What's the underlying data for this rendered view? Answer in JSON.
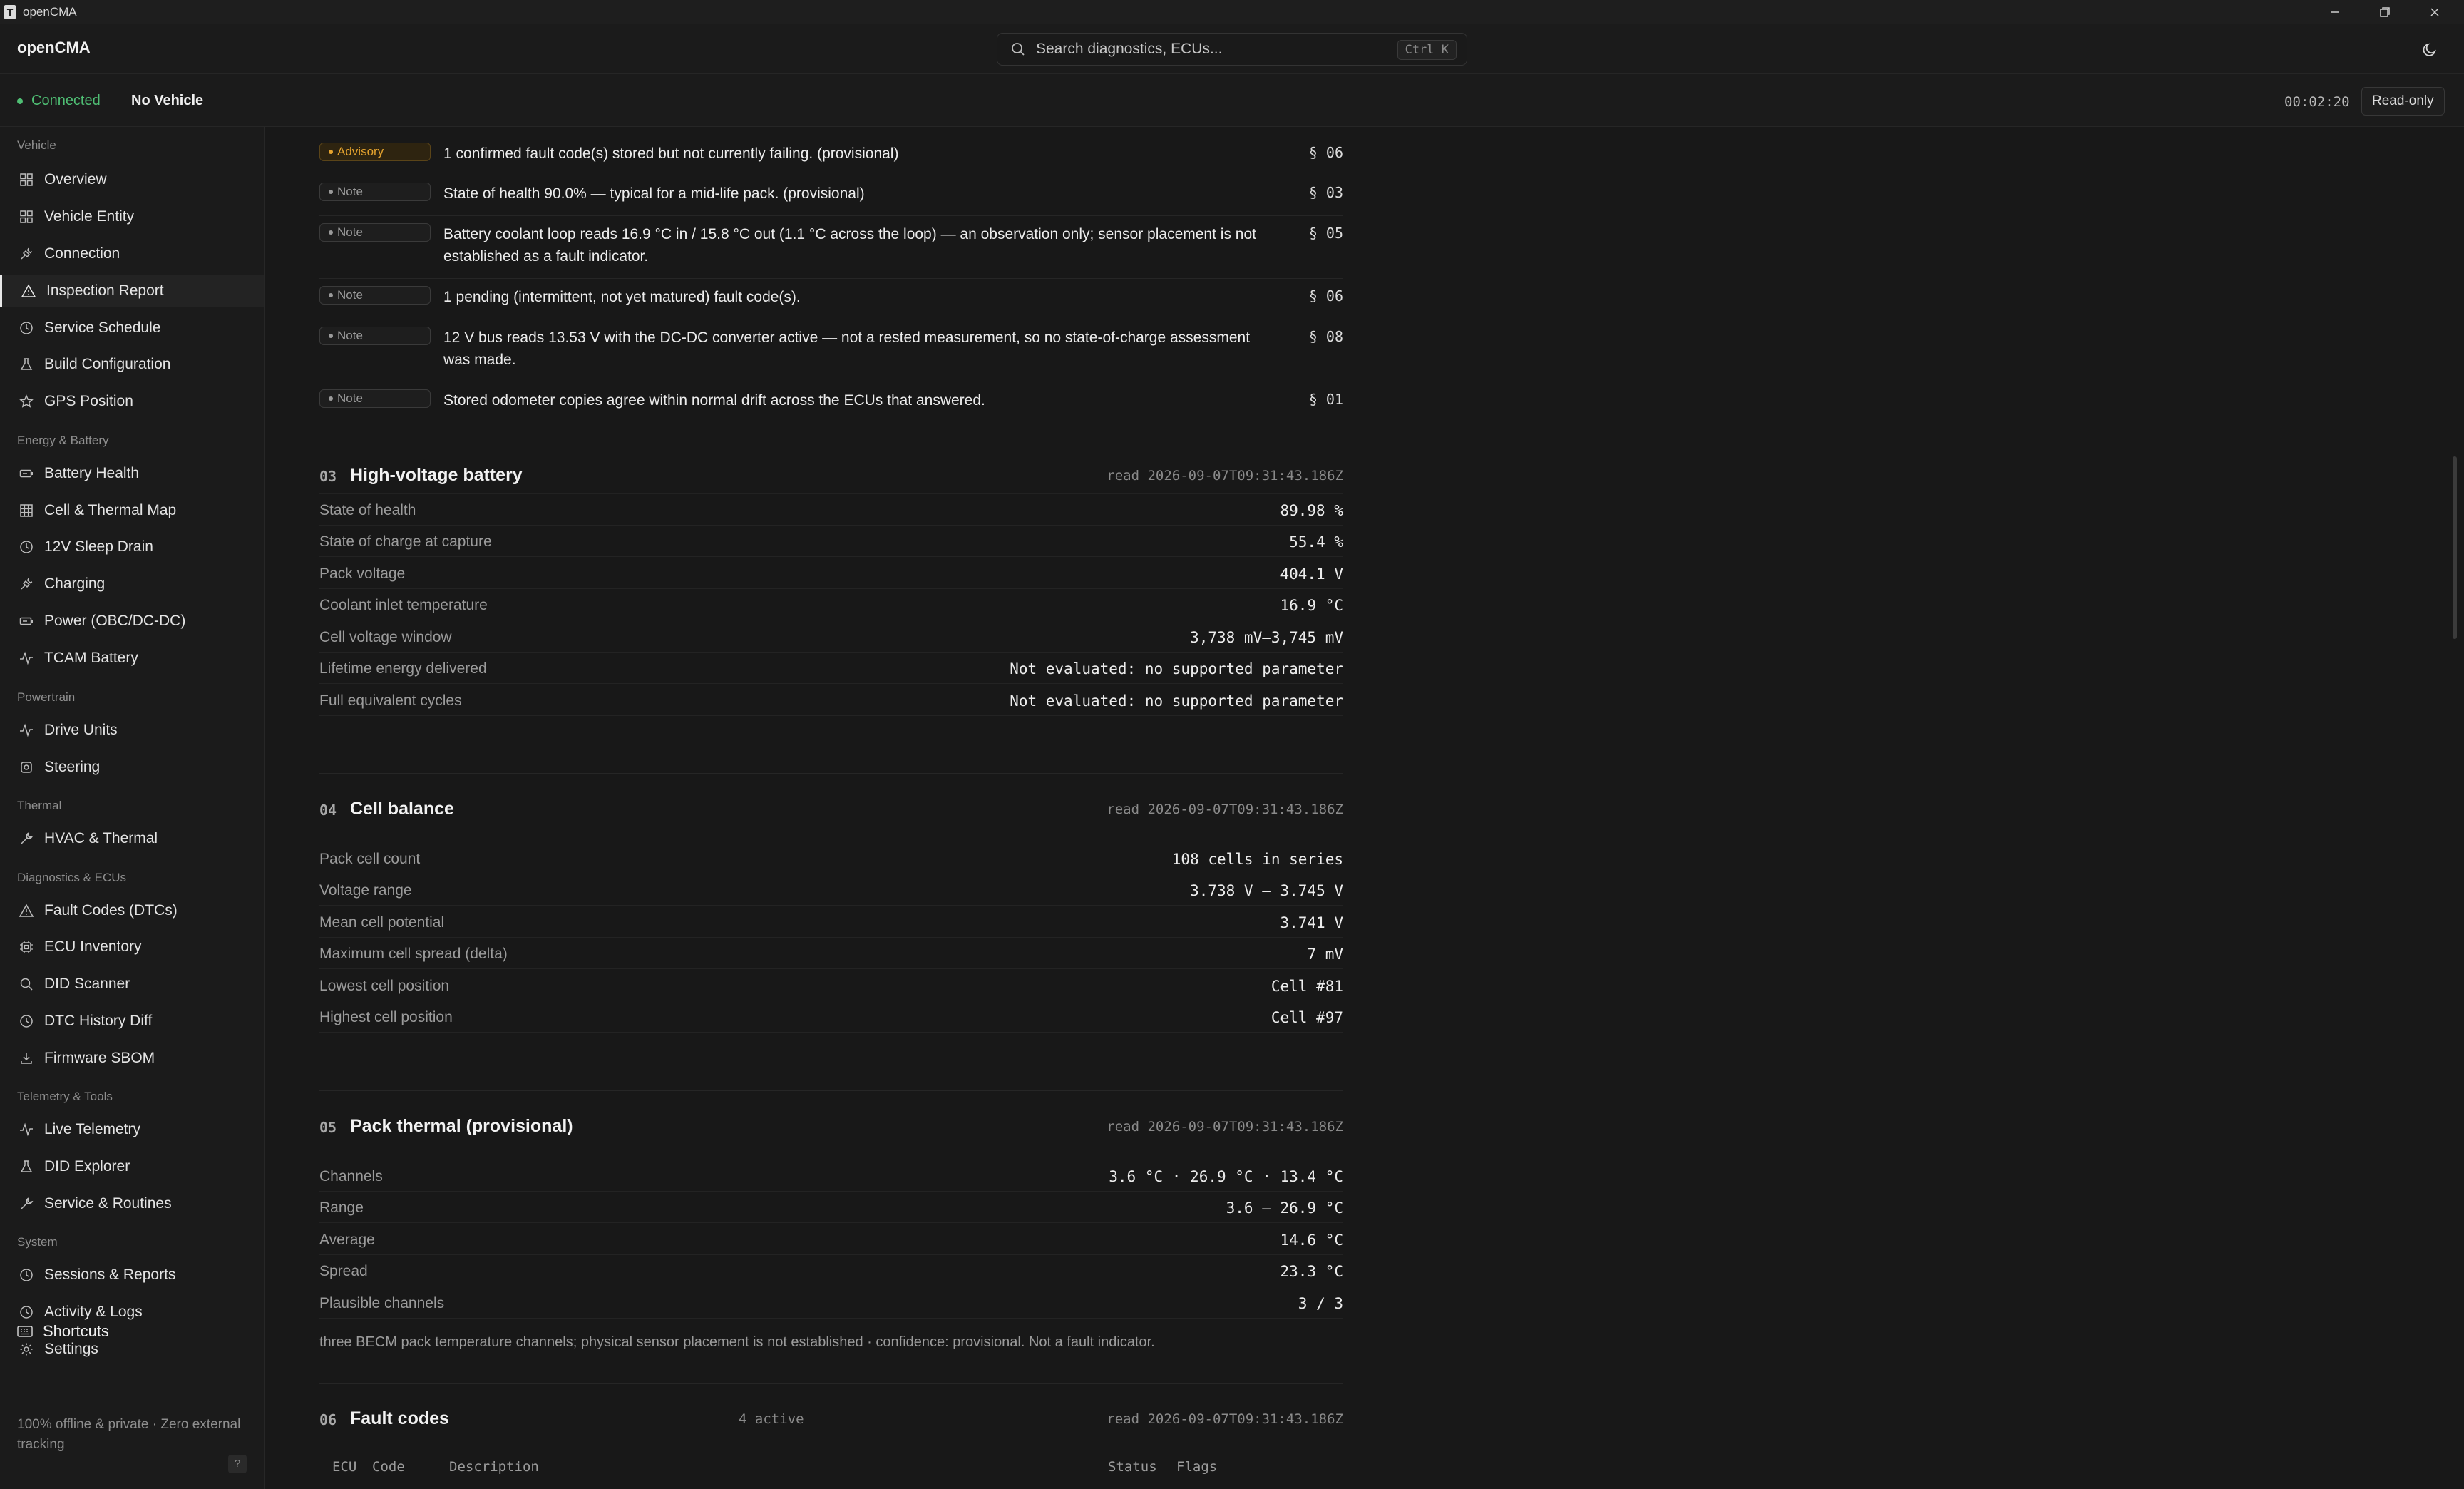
{
  "window": {
    "title": "openCMA",
    "icon_letter": "T"
  },
  "header": {
    "brand": "openCMA",
    "search_placeholder": "Search diagnostics, ECUs...",
    "search_shortcut": "Ctrl K"
  },
  "status": {
    "connection": "Connected",
    "vehicle": "No Vehicle",
    "timer": "00:02:20",
    "mode": "Read-only"
  },
  "sidebar": {
    "groups": {
      "vehicle": "Vehicle",
      "energy": "Energy & Battery",
      "powertrain": "Powertrain",
      "thermal": "Thermal",
      "diagnostics": "Diagnostics & ECUs",
      "telemetry": "Telemetry & Tools",
      "system": "System"
    },
    "items": {
      "overview": "Overview",
      "vehicle_entity": "Vehicle Entity",
      "connection": "Connection",
      "inspection_report": "Inspection Report",
      "service_schedule": "Service Schedule",
      "build_configuration": "Build Configuration",
      "gps_position": "GPS Position",
      "battery_health": "Battery Health",
      "cell_thermal_map": "Cell & Thermal Map",
      "sleep_drain": "12V Sleep Drain",
      "charging": "Charging",
      "power": "Power (OBC/DC-DC)",
      "tcam_battery": "TCAM Battery",
      "drive_units": "Drive Units",
      "steering": "Steering",
      "hvac": "HVAC & Thermal",
      "fault_codes": "Fault Codes (DTCs)",
      "ecu_inventory": "ECU Inventory",
      "did_scanner": "DID Scanner",
      "dtc_history_diff": "DTC History Diff",
      "firmware_sbom": "Firmware SBOM",
      "live_telemetry": "Live Telemetry",
      "did_explorer": "DID Explorer",
      "service_routines": "Service & Routines",
      "sessions_reports": "Sessions & Reports",
      "activity_logs": "Activity & Logs",
      "settings": "Settings"
    },
    "footer_note": "100% offline & private · Zero external tracking",
    "shortcuts": "Shortcuts",
    "help": "?"
  },
  "findings": [
    {
      "tag": "Advisory",
      "text": "1 confirmed fault code(s) stored but not currently failing. (provisional)",
      "ref": "§ 06"
    },
    {
      "tag": "Note",
      "text": "State of health 90.0% — typical for a mid-life pack. (provisional)",
      "ref": "§ 03"
    },
    {
      "tag": "Note",
      "text": "Battery coolant loop reads 16.9 °C in / 15.8 °C out (1.1 °C across the loop) — an observation only; sensor placement is not established as a fault indicator.",
      "ref": "§ 05"
    },
    {
      "tag": "Note",
      "text": "1 pending (intermittent, not yet matured) fault code(s).",
      "ref": "§ 06"
    },
    {
      "tag": "Note",
      "text": "12 V bus reads 13.53 V with the DC-DC converter active — not a rested measurement, so no state-of-charge assessment was made.",
      "ref": "§ 08"
    },
    {
      "tag": "Note",
      "text": "Stored odometer copies agree within normal drift across the ECUs that answered.",
      "ref": "§ 01"
    }
  ],
  "sections": {
    "hv": {
      "num": "03",
      "title": "High-voltage battery",
      "read": "read 2026-09-07T09:31:43.186Z",
      "rows": [
        {
          "k": "State of health",
          "v": "89.98 %"
        },
        {
          "k": "State of charge at capture",
          "v": "55.4 %"
        },
        {
          "k": "Pack voltage",
          "v": "404.1 V"
        },
        {
          "k": "Coolant inlet temperature",
          "v": "16.9 °C"
        },
        {
          "k": "Cell voltage window",
          "v": "3,738 mV–3,745 mV"
        },
        {
          "k": "Lifetime energy delivered",
          "v": "Not evaluated: no supported parameter"
        },
        {
          "k": "Full equivalent cycles",
          "v": "Not evaluated: no supported parameter"
        }
      ]
    },
    "cb": {
      "num": "04",
      "title": "Cell balance",
      "read": "read 2026-09-07T09:31:43.186Z",
      "rows": [
        {
          "k": "Pack cell count",
          "v": "108 cells in series"
        },
        {
          "k": "Voltage range",
          "v": "3.738 V – 3.745 V"
        },
        {
          "k": "Mean cell potential",
          "v": "3.741 V"
        },
        {
          "k": "Maximum cell spread (delta)",
          "v": "7 mV"
        },
        {
          "k": "Lowest cell position",
          "v": "Cell #81"
        },
        {
          "k": "Highest cell position",
          "v": "Cell #97"
        }
      ]
    },
    "pt": {
      "num": "05",
      "title": "Pack thermal (provisional)",
      "read": "read 2026-09-07T09:31:43.186Z",
      "rows": [
        {
          "k": "Channels",
          "v": "3.6 °C · 26.9 °C · 13.4 °C"
        },
        {
          "k": "Range",
          "v": "3.6 – 26.9 °C"
        },
        {
          "k": "Average",
          "v": "14.6 °C"
        },
        {
          "k": "Spread",
          "v": "23.3 °C"
        },
        {
          "k": "Plausible channels",
          "v": "3 / 3"
        }
      ],
      "note": "three BECM pack temperature channels; physical sensor placement is not established · confidence: provisional. Not a fault indicator."
    },
    "fc": {
      "num": "06",
      "title": "Fault codes",
      "active": "4 active",
      "read": "read 2026-09-07T09:31:43.186Z",
      "columns": {
        "ecu": "ECU",
        "code": "Code",
        "description": "Description",
        "status": "Status",
        "flags": "Flags"
      }
    }
  }
}
